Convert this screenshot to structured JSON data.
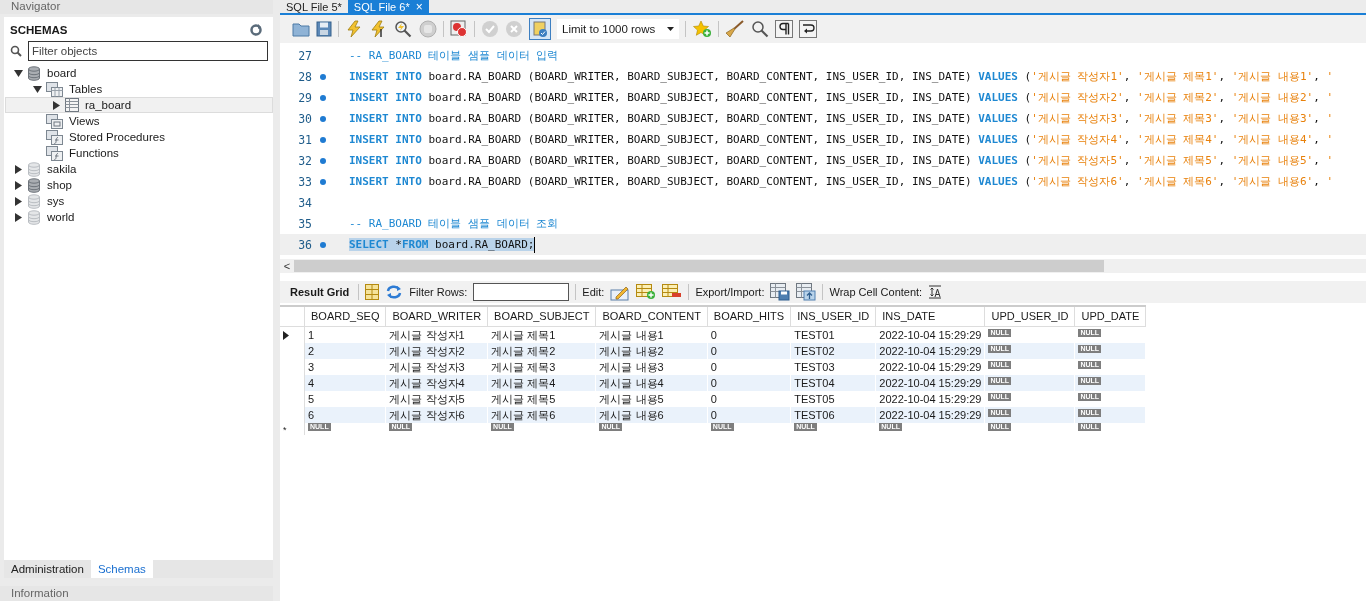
{
  "navigator": {
    "title": "Navigator",
    "heading": "SCHEMAS",
    "filter": {
      "placeholder": "Filter objects"
    },
    "tree": [
      {
        "label": "board",
        "kind": "schema",
        "emphasized": true,
        "expanded": true,
        "selected": false,
        "children": [
          {
            "label": "Tables",
            "kind": "tables",
            "expanded": true,
            "selected": false,
            "children": [
              {
                "label": "ra_board",
                "kind": "table",
                "expanded": false,
                "selected": true
              }
            ]
          },
          {
            "label": "Views",
            "kind": "views",
            "selected": false
          },
          {
            "label": "Stored Procedures",
            "kind": "routines",
            "selected": false
          },
          {
            "label": "Functions",
            "kind": "routines",
            "selected": false
          }
        ]
      },
      {
        "label": "sakila",
        "kind": "schema",
        "emphasized": false,
        "expanded": false,
        "selected": false
      },
      {
        "label": "shop",
        "kind": "schema",
        "emphasized": true,
        "expanded": false,
        "selected": false
      },
      {
        "label": "sys",
        "kind": "schema",
        "emphasized": false,
        "expanded": false,
        "selected": false
      },
      {
        "label": "world",
        "kind": "schema",
        "emphasized": false,
        "expanded": false,
        "selected": false
      }
    ],
    "bottom_tabs": [
      {
        "label": "Administration",
        "selected": false
      },
      {
        "label": "Schemas",
        "selected": true
      }
    ],
    "info_title": "Information"
  },
  "editor_tabs": [
    {
      "label": "SQL File 5*",
      "selected": false
    },
    {
      "label": "SQL File 6*",
      "selected": true,
      "close": "×"
    }
  ],
  "editor_toolbar": {
    "autocommit_pressed": true,
    "limit": "Limit to 1000 rows"
  },
  "editor_lines": [
    {
      "number": "27",
      "marker": false,
      "selected": false,
      "segments": [
        {
          "kind": "comment",
          "text": "-- RA_BOARD 테이블 샘플 데이터 입력"
        }
      ]
    },
    {
      "number": "28",
      "marker": true,
      "selected": false,
      "segments": [
        {
          "kind": "keyword",
          "text": "INSERT INTO"
        },
        {
          "kind": "text",
          "text": " board.RA_BOARD (BOARD_WRITER, BOARD_SUBJECT, BOARD_CONTENT, INS_USER_ID, INS_DATE) "
        },
        {
          "kind": "keyword",
          "text": "VALUES"
        },
        {
          "kind": "text",
          "text": " ("
        },
        {
          "kind": "string",
          "text": "'게시글 작성자1'"
        },
        {
          "kind": "text",
          "text": ", "
        },
        {
          "kind": "string",
          "text": "'게시글 제목1'"
        },
        {
          "kind": "text",
          "text": ", "
        },
        {
          "kind": "string",
          "text": "'게시글 내용1'"
        },
        {
          "kind": "text",
          "text": ", "
        },
        {
          "kind": "string",
          "text": "'"
        }
      ]
    },
    {
      "number": "29",
      "marker": true,
      "selected": false,
      "segments": [
        {
          "kind": "keyword",
          "text": "INSERT INTO"
        },
        {
          "kind": "text",
          "text": " board.RA_BOARD (BOARD_WRITER, BOARD_SUBJECT, BOARD_CONTENT, INS_USER_ID, INS_DATE) "
        },
        {
          "kind": "keyword",
          "text": "VALUES"
        },
        {
          "kind": "text",
          "text": " ("
        },
        {
          "kind": "string",
          "text": "'게시글 작성자2'"
        },
        {
          "kind": "text",
          "text": ", "
        },
        {
          "kind": "string",
          "text": "'게시글 제목2'"
        },
        {
          "kind": "text",
          "text": ", "
        },
        {
          "kind": "string",
          "text": "'게시글 내용2'"
        },
        {
          "kind": "text",
          "text": ", "
        },
        {
          "kind": "string",
          "text": "'"
        }
      ]
    },
    {
      "number": "30",
      "marker": true,
      "selected": false,
      "segments": [
        {
          "kind": "keyword",
          "text": "INSERT INTO"
        },
        {
          "kind": "text",
          "text": " board.RA_BOARD (BOARD_WRITER, BOARD_SUBJECT, BOARD_CONTENT, INS_USER_ID, INS_DATE) "
        },
        {
          "kind": "keyword",
          "text": "VALUES"
        },
        {
          "kind": "text",
          "text": " ("
        },
        {
          "kind": "string",
          "text": "'게시글 작성자3'"
        },
        {
          "kind": "text",
          "text": ", "
        },
        {
          "kind": "string",
          "text": "'게시글 제목3'"
        },
        {
          "kind": "text",
          "text": ", "
        },
        {
          "kind": "string",
          "text": "'게시글 내용3'"
        },
        {
          "kind": "text",
          "text": ", "
        },
        {
          "kind": "string",
          "text": "'"
        }
      ]
    },
    {
      "number": "31",
      "marker": true,
      "selected": false,
      "segments": [
        {
          "kind": "keyword",
          "text": "INSERT INTO"
        },
        {
          "kind": "text",
          "text": " board.RA_BOARD (BOARD_WRITER, BOARD_SUBJECT, BOARD_CONTENT, INS_USER_ID, INS_DATE) "
        },
        {
          "kind": "keyword",
          "text": "VALUES"
        },
        {
          "kind": "text",
          "text": " ("
        },
        {
          "kind": "string",
          "text": "'게시글 작성자4'"
        },
        {
          "kind": "text",
          "text": ", "
        },
        {
          "kind": "string",
          "text": "'게시글 제목4'"
        },
        {
          "kind": "text",
          "text": ", "
        },
        {
          "kind": "string",
          "text": "'게시글 내용4'"
        },
        {
          "kind": "text",
          "text": ", "
        },
        {
          "kind": "string",
          "text": "'"
        }
      ]
    },
    {
      "number": "32",
      "marker": true,
      "selected": false,
      "segments": [
        {
          "kind": "keyword",
          "text": "INSERT INTO"
        },
        {
          "kind": "text",
          "text": " board.RA_BOARD (BOARD_WRITER, BOARD_SUBJECT, BOARD_CONTENT, INS_USER_ID, INS_DATE) "
        },
        {
          "kind": "keyword",
          "text": "VALUES"
        },
        {
          "kind": "text",
          "text": " ("
        },
        {
          "kind": "string",
          "text": "'게시글 작성자5'"
        },
        {
          "kind": "text",
          "text": ", "
        },
        {
          "kind": "string",
          "text": "'게시글 제목5'"
        },
        {
          "kind": "text",
          "text": ", "
        },
        {
          "kind": "string",
          "text": "'게시글 내용5'"
        },
        {
          "kind": "text",
          "text": ", "
        },
        {
          "kind": "string",
          "text": "'"
        }
      ]
    },
    {
      "number": "33",
      "marker": true,
      "selected": false,
      "segments": [
        {
          "kind": "keyword",
          "text": "INSERT INTO"
        },
        {
          "kind": "text",
          "text": " board.RA_BOARD (BOARD_WRITER, BOARD_SUBJECT, BOARD_CONTENT, INS_USER_ID, INS_DATE) "
        },
        {
          "kind": "keyword",
          "text": "VALUES"
        },
        {
          "kind": "text",
          "text": " ("
        },
        {
          "kind": "string",
          "text": "'게시글 작성자6'"
        },
        {
          "kind": "text",
          "text": ", "
        },
        {
          "kind": "string",
          "text": "'게시글 제목6'"
        },
        {
          "kind": "text",
          "text": ", "
        },
        {
          "kind": "string",
          "text": "'게시글 내용6'"
        },
        {
          "kind": "text",
          "text": ", "
        },
        {
          "kind": "string",
          "text": "'"
        }
      ]
    },
    {
      "number": "34",
      "marker": false,
      "selected": false
    },
    {
      "number": "35",
      "marker": false,
      "selected": false,
      "segments": [
        {
          "kind": "comment",
          "text": "-- RA_BOARD 테이블 샘플 데이터 조회"
        }
      ]
    },
    {
      "number": "36",
      "marker": true,
      "selected": true,
      "segments": [
        {
          "kind": "keyword",
          "text": "SELECT"
        },
        {
          "kind": "text",
          "text": " *"
        },
        {
          "kind": "keyword",
          "text": "FROM"
        },
        {
          "kind": "text",
          "text": " board.RA_BOARD;"
        }
      ]
    }
  ],
  "scroll_arrow": "<",
  "result_toolbar": {
    "result_tab": "Result Grid",
    "filter_label": "Filter Rows:",
    "edit_label": "Edit:",
    "export_label": "Export/Import:",
    "wrap_label": "Wrap Cell Content:"
  },
  "grid": {
    "columns": [
      "BOARD_SEQ",
      "BOARD_WRITER",
      "BOARD_SUBJECT",
      "BOARD_CONTENT",
      "BOARD_HITS",
      "INS_USER_ID",
      "INS_DATE",
      "UPD_USER_ID",
      "UPD_DATE"
    ],
    "rows": [
      {
        "current": true,
        "cells": [
          "1",
          "게시글 작성자1",
          "게시글 제목1",
          "게시글 내용1",
          "0",
          "TEST01",
          "2022-10-04 15:29:29",
          {
            "kind": "null",
            "text": "NULL"
          },
          {
            "kind": "null",
            "text": "NULL"
          }
        ]
      },
      {
        "current": false,
        "cells": [
          "2",
          "게시글 작성자2",
          "게시글 제목2",
          "게시글 내용2",
          "0",
          "TEST02",
          "2022-10-04 15:29:29",
          {
            "kind": "null",
            "text": "NULL"
          },
          {
            "kind": "null",
            "text": "NULL"
          }
        ]
      },
      {
        "current": false,
        "cells": [
          "3",
          "게시글 작성자3",
          "게시글 제목3",
          "게시글 내용3",
          "0",
          "TEST03",
          "2022-10-04 15:29:29",
          {
            "kind": "null",
            "text": "NULL"
          },
          {
            "kind": "null",
            "text": "NULL"
          }
        ]
      },
      {
        "current": false,
        "cells": [
          "4",
          "게시글 작성자4",
          "게시글 제목4",
          "게시글 내용4",
          "0",
          "TEST04",
          "2022-10-04 15:29:29",
          {
            "kind": "null",
            "text": "NULL"
          },
          {
            "kind": "null",
            "text": "NULL"
          }
        ]
      },
      {
        "current": false,
        "cells": [
          "5",
          "게시글 작성자5",
          "게시글 제목5",
          "게시글 내용5",
          "0",
          "TEST05",
          "2022-10-04 15:29:29",
          {
            "kind": "null",
            "text": "NULL"
          },
          {
            "kind": "null",
            "text": "NULL"
          }
        ]
      },
      {
        "current": false,
        "cells": [
          "6",
          "게시글 작성자6",
          "게시글 제목6",
          "게시글 내용6",
          "0",
          "TEST06",
          "2022-10-04 15:29:29",
          {
            "kind": "null",
            "text": "NULL"
          },
          {
            "kind": "null",
            "text": "NULL"
          }
        ]
      },
      {
        "current": false,
        "marker": "*",
        "cells": [
          {
            "kind": "null",
            "text": "NULL"
          },
          {
            "kind": "null",
            "text": "NULL"
          },
          {
            "kind": "null",
            "text": "NULL"
          },
          {
            "kind": "null",
            "text": "NULL"
          },
          {
            "kind": "null",
            "text": "NULL"
          },
          {
            "kind": "null",
            "text": "NULL"
          },
          {
            "kind": "null",
            "text": "NULL"
          },
          {
            "kind": "null",
            "text": "NULL"
          },
          {
            "kind": "null",
            "text": "NULL"
          }
        ]
      }
    ]
  }
}
